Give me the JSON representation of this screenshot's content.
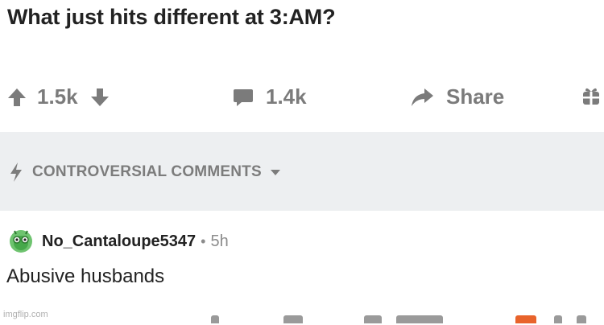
{
  "post": {
    "title": "What just hits different at 3:AM?"
  },
  "actions": {
    "upvote_icon": "arrow-up-icon",
    "vote_count": "1.5k",
    "downvote_icon": "arrow-down-icon",
    "comment_icon": "comment-bubble-icon",
    "comment_count": "1.4k",
    "share_icon": "share-arrow-icon",
    "share_label": "Share",
    "award_icon": "gift-icon"
  },
  "sort": {
    "icon": "lightning-icon",
    "label": "CONTROVERSIAL COMMENTS",
    "dropdown_icon": "caret-down-icon"
  },
  "comment": {
    "username": "No_Cantaloupe5347",
    "separator": "•",
    "time": "5h",
    "body": "Abusive husbands"
  },
  "watermark": "imgflip.com",
  "colors": {
    "icon_gray": "#7b7b7b",
    "sort_bg": "#edeff1",
    "award_orange": "#e8632b",
    "avatar_green": "#46a84a"
  }
}
